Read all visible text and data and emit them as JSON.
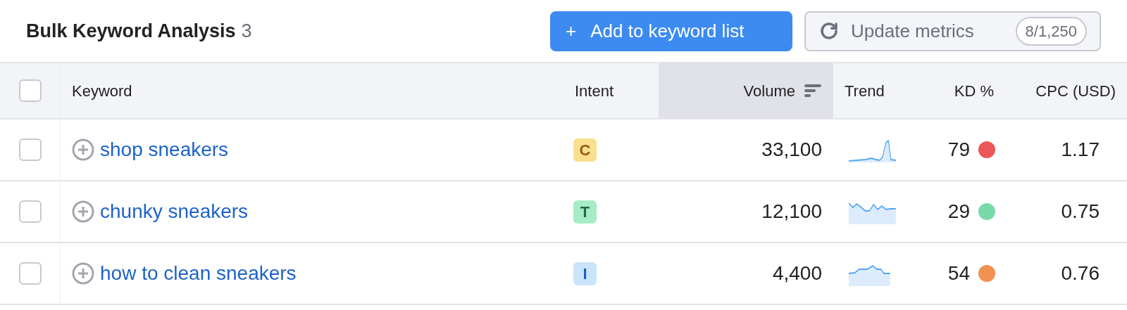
{
  "title": "Bulk Keyword Analysis",
  "count": "3",
  "buttons": {
    "add": {
      "icon": "+",
      "label": "Add to keyword list"
    },
    "update": {
      "label": "Update metrics",
      "badge": "8/1,250"
    }
  },
  "select_all": {
    "checked": false
  },
  "columns": [
    {
      "label": "Keyword",
      "sorted": false
    },
    {
      "label": "Intent",
      "sorted": false
    },
    {
      "label": "Volume",
      "sorted": true
    },
    {
      "label": "Trend",
      "sorted": false
    },
    {
      "label": "KD %",
      "sorted": false
    },
    {
      "label": "CPC (USD)",
      "sorted": false
    }
  ],
  "rows": [
    {
      "checked": false,
      "keyword": "shop sneakers",
      "intent": {
        "label": "C",
        "color": "#f8e08e"
      },
      "volume": "33,100",
      "kd": {
        "value": "79",
        "color": "#eb5757"
      },
      "cpc": "1.17"
    },
    {
      "checked": false,
      "keyword": "chunky sneakers",
      "intent": {
        "label": "T",
        "color": "#a8ecc6"
      },
      "volume": "12,100",
      "kd": {
        "value": "29",
        "color": "#7ad9a8"
      },
      "cpc": "0.75"
    },
    {
      "checked": false,
      "keyword": "how to clean sneakers",
      "intent": {
        "label": "I",
        "color": "#c9e4fb"
      },
      "volume": "4,400",
      "kd": {
        "value": "54",
        "color": "#f0914f"
      },
      "cpc": "0.76"
    }
  ]
}
